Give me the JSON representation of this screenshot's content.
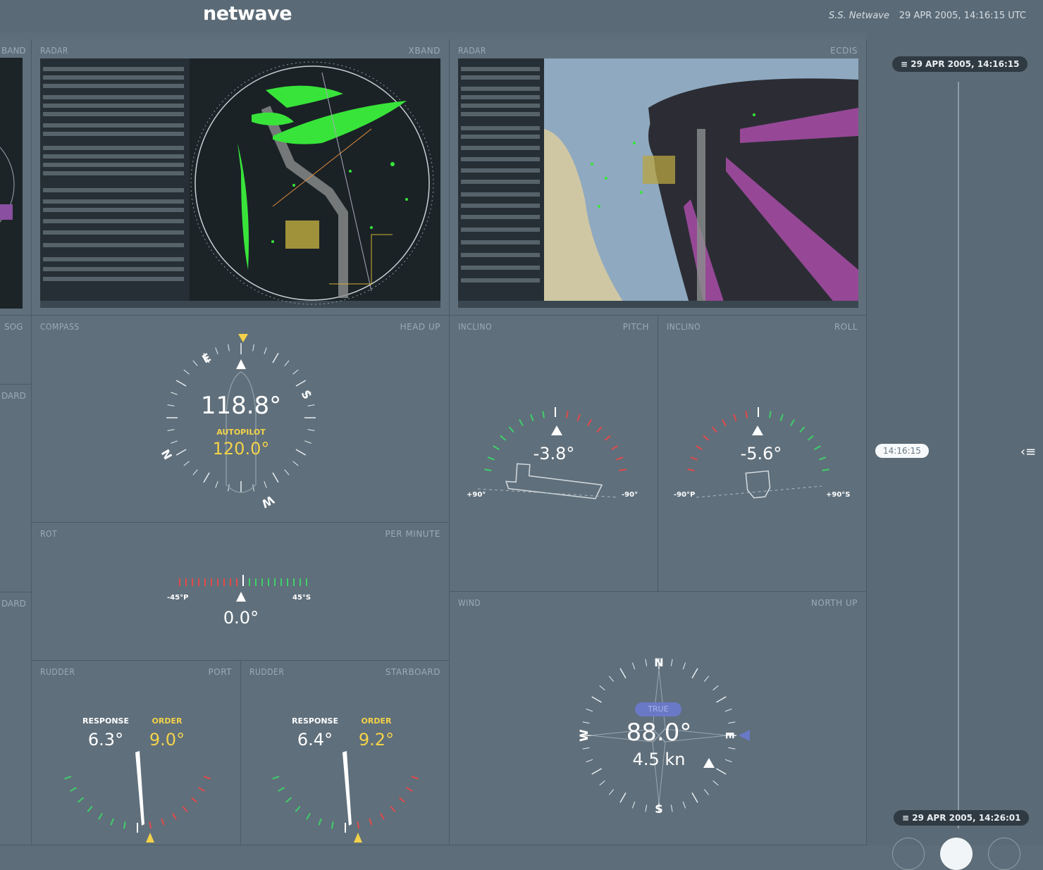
{
  "header": {
    "brand": "netwave",
    "ship": "S.S. Netwave",
    "datetime": "29 APR 2005, 14:16:15 UTC"
  },
  "left_stub": {
    "labels": [
      "BAND",
      "SOG",
      "DARD",
      "DARD"
    ]
  },
  "radar_x": {
    "title": "RADAR",
    "mode": "XBAND"
  },
  "radar_e": {
    "title": "RADAR",
    "mode": "ECDIS"
  },
  "compass": {
    "title": "COMPASS",
    "mode": "HEAD UP",
    "heading": "118.8°",
    "autopilot_label": "AUTOPILOT",
    "autopilot_value": "120.0°",
    "cardinals": [
      "E",
      "S",
      "W",
      "N"
    ]
  },
  "pitch": {
    "title": "INCLINO",
    "mode": "PITCH",
    "value": "-3.8°",
    "left_label": "+90°",
    "right_label": "-90°"
  },
  "roll": {
    "title": "INCLINO",
    "mode": "ROLL",
    "value": "-5.6°",
    "left_label": "-90°P",
    "right_label": "+90°S"
  },
  "rot": {
    "title": "ROT",
    "mode": "PER MINUTE",
    "value": "0.0°",
    "left_label": "-45°P",
    "right_label": "45°S"
  },
  "wind": {
    "title": "WIND",
    "mode": "NORTH UP",
    "badge": "TRUE",
    "direction": "88.0°",
    "speed": "4.5 kn",
    "cardinals": [
      "N",
      "E",
      "S",
      "W"
    ]
  },
  "rudder_port": {
    "title": "RUDDER",
    "mode": "PORT",
    "response_label": "RESPONSE",
    "order_label": "ORDER",
    "response": "6.3°",
    "order": "9.0°"
  },
  "rudder_stbd": {
    "title": "RUDDER",
    "mode": "STARBOARD",
    "response_label": "RESPONSE",
    "order_label": "ORDER",
    "response": "6.4°",
    "order": "9.2°"
  },
  "timeline": {
    "top": "29 APR 2005, 14:16:15",
    "current": "14:16:15",
    "bottom": "29 APR 2005, 14:26:01"
  },
  "colors": {
    "background": "#5f6f7b",
    "accent_yellow": "#f3d24a",
    "scale_green": "#3fd06a",
    "scale_red": "#e24a4a",
    "radar_green": "#39e43a",
    "ecdis_magenta": "#b14fb0"
  }
}
